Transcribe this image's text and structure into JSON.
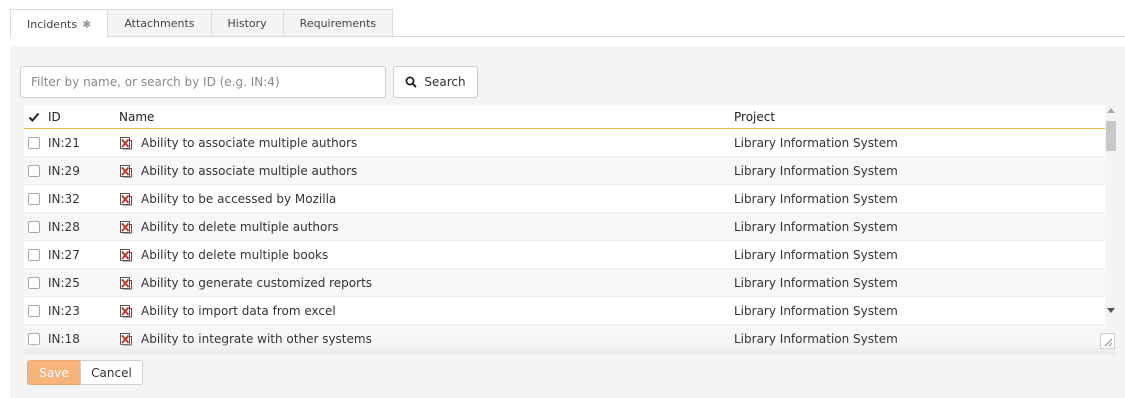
{
  "tabs": [
    {
      "label": "Incidents",
      "active": true
    },
    {
      "label": "Attachments",
      "active": false
    },
    {
      "label": "History",
      "active": false
    },
    {
      "label": "Requirements",
      "active": false
    }
  ],
  "search": {
    "placeholder": "Filter by name, or search by ID (e.g. IN:4)",
    "button_label": "Search"
  },
  "table": {
    "columns": {
      "id": "ID",
      "name": "Name",
      "project": "Project"
    },
    "rows": [
      {
        "id": "IN:21",
        "name": "Ability to associate multiple authors",
        "project": "Library Information System"
      },
      {
        "id": "IN:29",
        "name": "Ability to associate multiple authors",
        "project": "Library Information System"
      },
      {
        "id": "IN:32",
        "name": "Ability to be accessed by Mozilla",
        "project": "Library Information System"
      },
      {
        "id": "IN:28",
        "name": "Ability to delete multiple authors",
        "project": "Library Information System"
      },
      {
        "id": "IN:27",
        "name": "Ability to delete multiple books",
        "project": "Library Information System"
      },
      {
        "id": "IN:25",
        "name": "Ability to generate customized reports",
        "project": "Library Information System"
      },
      {
        "id": "IN:23",
        "name": "Ability to import data from excel",
        "project": "Library Information System"
      },
      {
        "id": "IN:18",
        "name": "Ability to integrate with other systems",
        "project": "Library Information System"
      }
    ]
  },
  "footer": {
    "save_label": "Save",
    "cancel_label": "Cancel"
  },
  "colors": {
    "accent": "#f6b37a",
    "header_underline": "#f0c040",
    "incident_icon": "#c0392b"
  }
}
